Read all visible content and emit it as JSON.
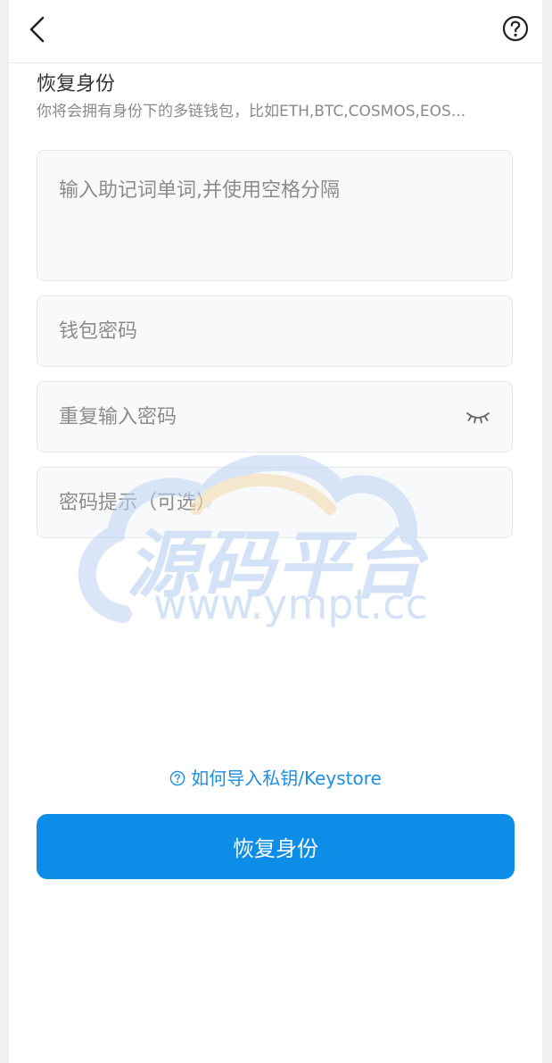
{
  "header": {
    "back_icon": "chevron-left-icon",
    "help_icon": "question-circle-icon"
  },
  "page": {
    "title": "恢复身份",
    "subtitle": "你将会拥有身份下的多链钱包，比如ETH,BTC,COSMOS,EOS..."
  },
  "form": {
    "mnemonic_placeholder": "输入助记词单词,并使用空格分隔",
    "password_placeholder": "钱包密码",
    "repeat_password_placeholder": "重复输入密码",
    "hint_placeholder": "密码提示（可选）",
    "eye_icon": "eye-closed-icon"
  },
  "watermark": {
    "text": "源码平台",
    "url": "www.ympt.cc"
  },
  "help_link": {
    "label": "如何导入私钥/Keystore",
    "icon": "question-circle-icon"
  },
  "submit_label": "恢复身份",
  "colors": {
    "accent": "#0c8ee8",
    "link": "#1a8fe3",
    "field_bg": "#f7f9fb"
  }
}
